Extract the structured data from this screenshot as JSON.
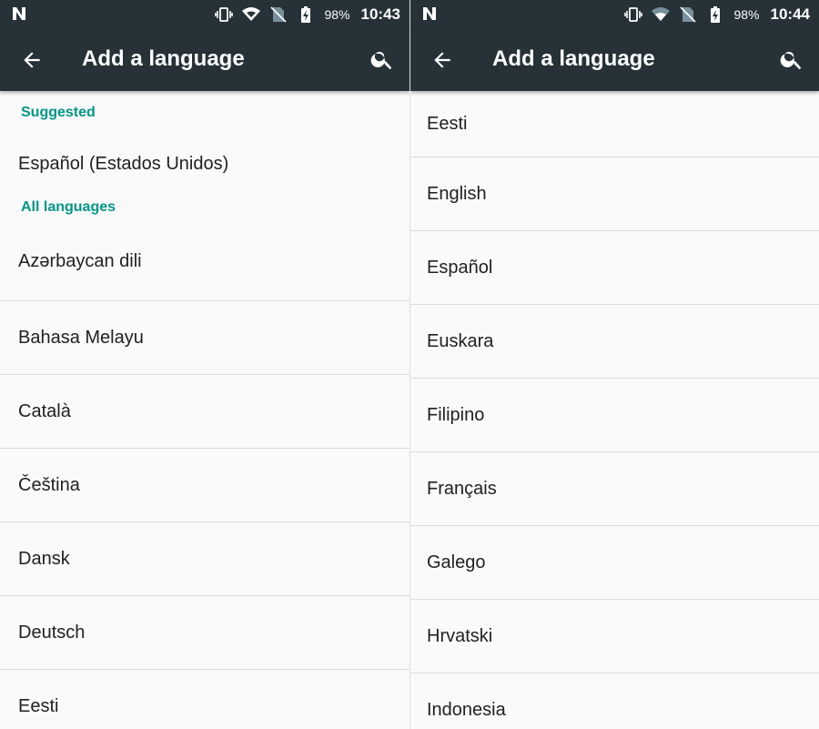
{
  "left": {
    "status": {
      "battery": "98%",
      "time": "10:43"
    },
    "appbar": {
      "title": "Add a language"
    },
    "suggested_header": "Suggested",
    "suggested": [
      "Español (Estados Unidos)"
    ],
    "all_header": "All languages",
    "all": [
      "Azərbaycan dili",
      "Bahasa Melayu",
      "Català",
      "Čeština",
      "Dansk",
      "Deutsch",
      "Eesti"
    ]
  },
  "right": {
    "status": {
      "battery": "98%",
      "time": "10:44"
    },
    "appbar": {
      "title": "Add a language"
    },
    "all": [
      "Eesti",
      "English",
      "Español",
      "Euskara",
      "Filipino",
      "Français",
      "Galego",
      "Hrvatski",
      "Indonesia"
    ]
  },
  "colors": {
    "appbar": "#263238",
    "accent": "#009688",
    "background": "#fafafa"
  }
}
